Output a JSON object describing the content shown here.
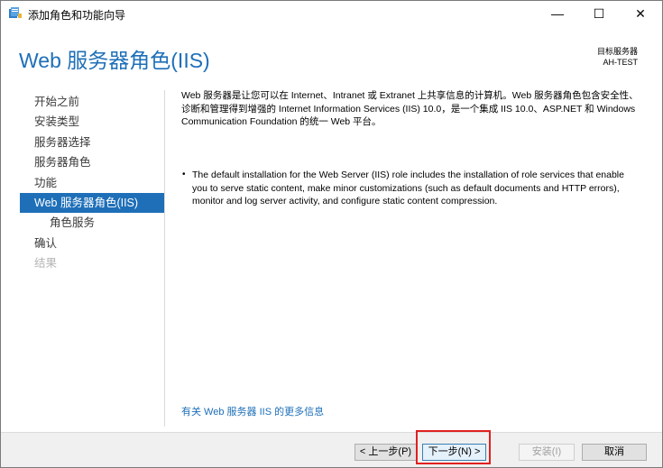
{
  "window": {
    "title": "添加角色和功能向导",
    "minimize": "—",
    "maximize": "☐",
    "close": "✕"
  },
  "header": {
    "page_title": "Web 服务器角色(IIS)",
    "dest_label": "目标服务器",
    "dest_value": "AH-TEST"
  },
  "nav": {
    "items": [
      {
        "label": "开始之前",
        "state": "normal"
      },
      {
        "label": "安装类型",
        "state": "normal"
      },
      {
        "label": "服务器选择",
        "state": "normal"
      },
      {
        "label": "服务器角色",
        "state": "normal"
      },
      {
        "label": "功能",
        "state": "normal"
      },
      {
        "label": "Web 服务器角色(IIS)",
        "state": "active"
      },
      {
        "label": "角色服务",
        "state": "sub"
      },
      {
        "label": "确认",
        "state": "normal"
      },
      {
        "label": "结果",
        "state": "disabled"
      }
    ]
  },
  "content": {
    "intro": "Web 服务器是让您可以在 Internet、Intranet 或 Extranet 上共享信息的计算机。Web 服务器角色包含安全性、诊断和管理得到增强的 Internet Information Services (IIS) 10.0，是一个集成 IIS 10.0、ASP.NET 和 Windows Communication Foundation 的统一 Web 平台。",
    "bullet": "The default installation for the Web Server (IIS) role includes the installation of role services that enable you to serve static content, make minor customizations (such as default documents and HTTP errors), monitor and log server activity, and configure static content compression.",
    "bullet_symbol": "•",
    "more_link": "有关 Web 服务器 IIS 的更多信息"
  },
  "footer": {
    "prev": "< 上一步(P)",
    "next": "下一步(N) >",
    "install": "安装(I)",
    "cancel": "取消"
  },
  "colors": {
    "accent": "#1e6fb8",
    "highlight": "#e02020"
  }
}
